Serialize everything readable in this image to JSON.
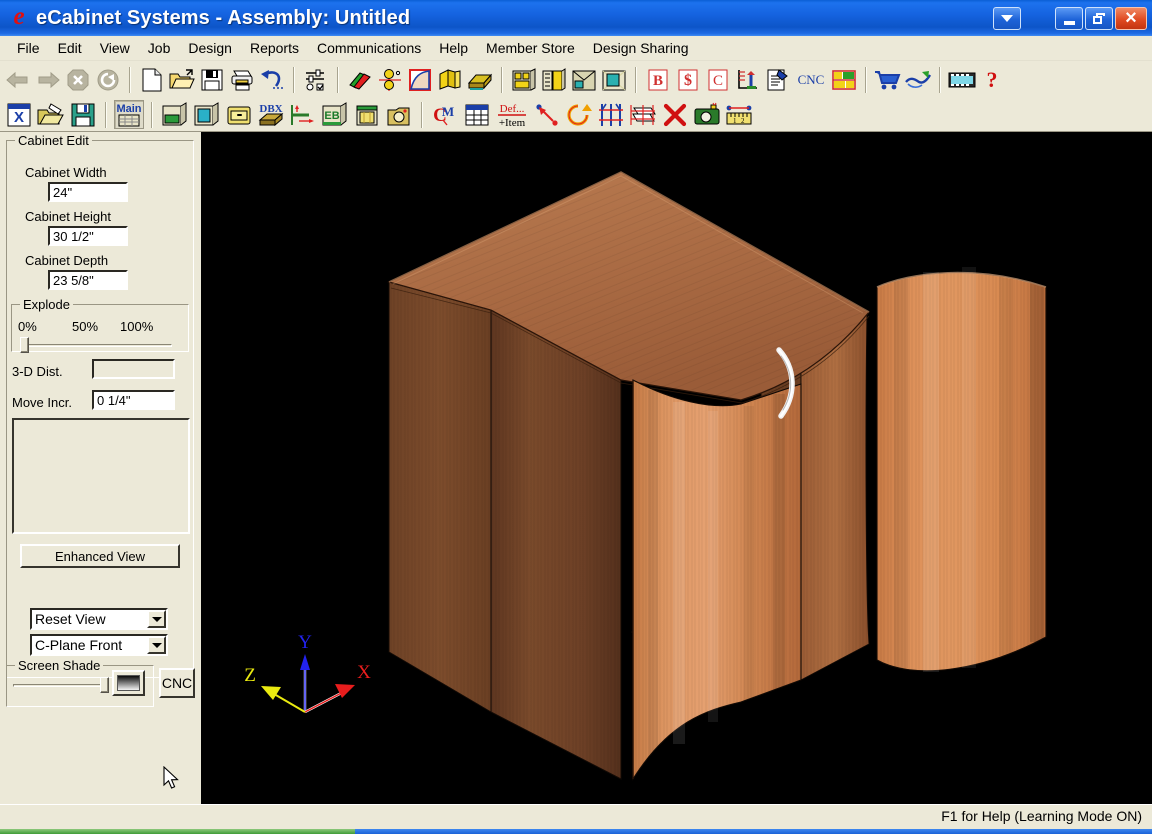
{
  "window": {
    "title": "eCabinet Systems - Assembly: Untitled",
    "logo_glyph": "e",
    "controls": [
      {
        "name": "dropdown-button",
        "glyph": "down-triangle"
      },
      {
        "name": "minimize-button",
        "glyph": "minimize"
      },
      {
        "name": "restore-button",
        "glyph": "restore"
      },
      {
        "name": "close-button",
        "glyph": "close-x",
        "label": "×"
      }
    ],
    "titlebar_color": "#1563e0",
    "close_color": "#e04b22"
  },
  "menu": {
    "items": [
      "File",
      "Edit",
      "View",
      "Job",
      "Design",
      "Reports",
      "Communications",
      "Help",
      "Member Store",
      "Design Sharing"
    ]
  },
  "toolbar_primary": {
    "groups": [
      {
        "name": "navigation",
        "icons": [
          {
            "name": "back-arrow-icon",
            "label": "Back",
            "disabled": true
          },
          {
            "name": "forward-arrow-icon",
            "label": "Forward",
            "disabled": true
          },
          {
            "name": "stop-icon",
            "label": "Stop",
            "disabled": true
          },
          {
            "name": "refresh-icon",
            "label": "Refresh",
            "disabled": true
          }
        ]
      },
      {
        "name": "file-operations",
        "icons": [
          {
            "name": "new-document-icon",
            "label": "New"
          },
          {
            "name": "open-folder-icon",
            "label": "Open"
          },
          {
            "name": "save-floppy-icon",
            "label": "Save"
          },
          {
            "name": "print-icon",
            "label": "Print"
          },
          {
            "name": "undo-icon",
            "label": "Undo"
          }
        ]
      },
      {
        "name": "settings",
        "icons": [
          {
            "name": "preferences-icon",
            "label": "Preferences"
          }
        ]
      },
      {
        "name": "design-tools",
        "icons": [
          {
            "name": "materials-icon",
            "label": "Materials"
          },
          {
            "name": "hardware-icon",
            "label": "Hardware"
          },
          {
            "name": "shape-editor-icon",
            "label": "Shape Editor"
          },
          {
            "name": "moulding-icon",
            "label": "Moulding"
          },
          {
            "name": "panel-icon",
            "label": "Panel"
          }
        ]
      },
      {
        "name": "cabinet-views",
        "icons": [
          {
            "name": "cabinet-front-icon",
            "label": "Cabinet Front"
          },
          {
            "name": "cabinet-library-icon",
            "label": "Cabinet Library"
          },
          {
            "name": "elevation-icon",
            "label": "Elevation"
          },
          {
            "name": "floorplan-icon",
            "label": "Floor Plan"
          }
        ]
      },
      {
        "name": "reports",
        "icons": [
          {
            "name": "bid-report-icon",
            "label": "B"
          },
          {
            "name": "pricing-icon",
            "label": "$"
          },
          {
            "name": "cutlist-icon",
            "label": "C"
          },
          {
            "name": "measure-report-icon",
            "label": "Measure"
          },
          {
            "name": "notes-icon",
            "label": "Notes"
          },
          {
            "name": "cnc-text-icon",
            "label": "CNC"
          },
          {
            "name": "nesting-icon",
            "label": "Nesting"
          }
        ]
      },
      {
        "name": "commerce",
        "icons": [
          {
            "name": "shopping-cart-icon",
            "label": "Store"
          },
          {
            "name": "handshake-icon",
            "label": "Sharing"
          }
        ]
      },
      {
        "name": "media-help",
        "icons": [
          {
            "name": "video-icon",
            "label": "Video"
          },
          {
            "name": "help-question-icon",
            "label": "?"
          }
        ]
      }
    ]
  },
  "toolbar_secondary": {
    "groups": [
      {
        "name": "assembly-file",
        "icons": [
          {
            "name": "assembly-new-icon",
            "label": "New Assembly"
          },
          {
            "name": "assembly-open-icon",
            "label": "Open Assembly"
          },
          {
            "name": "assembly-save-icon",
            "label": "Save Assembly"
          }
        ]
      },
      {
        "name": "main-group",
        "icons": [
          {
            "name": "main-assembly-icon",
            "label": "Main",
            "pressed": true
          }
        ]
      },
      {
        "name": "construction",
        "icons": [
          {
            "name": "box-construct-icon",
            "label": "Box"
          },
          {
            "name": "frame-construct-icon",
            "label": "Frame"
          },
          {
            "name": "drawer-icon",
            "label": "Drawer"
          },
          {
            "name": "dbx-icon",
            "label": "DBX"
          },
          {
            "name": "dimension-icon",
            "label": "Dimension"
          },
          {
            "name": "edgebanding-icon",
            "label": "EB"
          },
          {
            "name": "door-icon",
            "label": "Door"
          },
          {
            "name": "hardware-place-icon",
            "label": "Hardware"
          }
        ]
      },
      {
        "name": "modify",
        "icons": [
          {
            "name": "member-copy-icon",
            "label": "Copy Member"
          },
          {
            "name": "spreadsheet-icon",
            "label": "Spreadsheet"
          },
          {
            "name": "define-item-icon",
            "label": "Def...\n+Item"
          },
          {
            "name": "move-point-icon",
            "label": "Move"
          },
          {
            "name": "rotate-icon",
            "label": "Rotate"
          },
          {
            "name": "align-icon",
            "label": "Align"
          },
          {
            "name": "array-icon",
            "label": "Array"
          },
          {
            "name": "delete-icon",
            "label": "Delete"
          },
          {
            "name": "camera-icon",
            "label": "Camera"
          },
          {
            "name": "ruler-icon",
            "label": "Measure"
          }
        ]
      }
    ]
  },
  "cabinet_edit": {
    "group_label": "Cabinet Edit",
    "fields": [
      {
        "name": "cabinet-width",
        "label": "Cabinet Width",
        "value": "24\""
      },
      {
        "name": "cabinet-height",
        "label": "Cabinet Height",
        "value": "30 1/2\""
      },
      {
        "name": "cabinet-depth",
        "label": "Cabinet Depth",
        "value": "23 5/8\""
      }
    ],
    "explode": {
      "label": "Explode",
      "ticks": [
        "0%",
        "50%",
        "100%"
      ],
      "value": 0,
      "min": 0,
      "max": 100
    },
    "dist_label": "3-D Dist.",
    "dist_value": "",
    "move_label": "Move Incr.",
    "move_value": "0 1/4\"",
    "enhanced_view_label": "Enhanced View"
  },
  "view_controls": {
    "reset_view": {
      "label": "Reset View",
      "name": "reset-view-combo"
    },
    "c_plane": {
      "label": "C-Plane Front",
      "name": "c-plane-combo"
    },
    "screen_shade": {
      "label": "Screen Shade",
      "value": 92
    },
    "cnc_button": "CNC"
  },
  "viewport": {
    "background": "#000000",
    "axis_gizmo": {
      "x_label": "X",
      "x_color": "#e81d1d",
      "y_label": "Y",
      "y_color": "#2222ee",
      "z_label": "Z",
      "z_color": "#eaea10"
    },
    "model": {
      "name": "curved-front-cabinet",
      "case_side_color": "#7a4a2b",
      "case_top_color": "#b5714a",
      "door_color": "#d4834d",
      "detached_door_color": "#d88a53",
      "handle_color": "#e8e8e8"
    }
  },
  "statusbar": {
    "text": "F1 for Help (Learning Mode ON)"
  }
}
